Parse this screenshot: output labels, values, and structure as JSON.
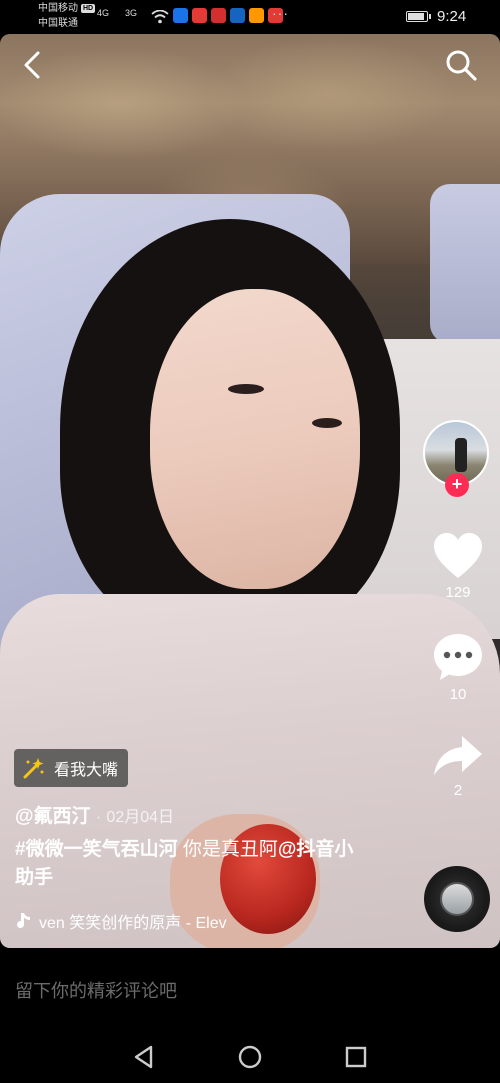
{
  "status_bar": {
    "carrier_1": "中国移动",
    "hd_badge": "HD",
    "carrier_2": "中国联通",
    "signal_1": "4G",
    "signal_2": "3G",
    "time": "9:24",
    "battery_level": 0.8,
    "app_icons": [
      "#1a73e8",
      "#e53935",
      "#d32f2f",
      "#1565c0",
      "#ff9800",
      "#e53935"
    ]
  },
  "video": {
    "effect_label": "看我大嘴",
    "author": "@氟西汀",
    "date_separator": "·",
    "date": "02月04日",
    "caption_tag": "#微微一笑气吞山河",
    "caption_text": " 你是真丑阿",
    "caption_mention": "@抖音小助手",
    "music_text": "ven  笑笑创作的原声 - Elev"
  },
  "actions": {
    "like_count": "129",
    "comment_count": "10",
    "share_count": "2",
    "follow_symbol": "+"
  },
  "comment_bar": {
    "placeholder": "留下你的精彩评论吧"
  },
  "colors": {
    "accent": "#fe2c55",
    "background": "#000000"
  }
}
